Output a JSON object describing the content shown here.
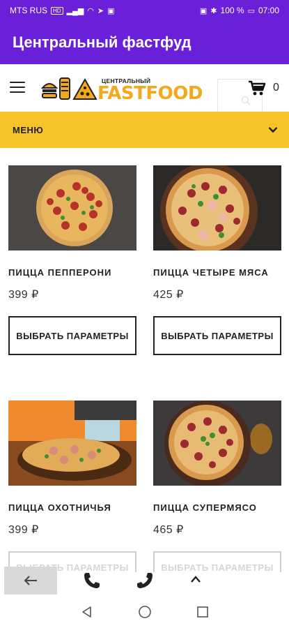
{
  "status_bar": {
    "carrier": "MTS RUS",
    "carrier_badge": "HD",
    "battery": "100 %",
    "time": "07:00"
  },
  "app_bar": {
    "title": "Центральный фастфуд"
  },
  "header": {
    "logo_small": "ЦЕНТРАЛЬНЫЙ",
    "logo_big": "FASTFOOD",
    "cart_count": "0"
  },
  "menu": {
    "label": "МЕНЮ"
  },
  "products": [
    {
      "name": "ПИЦЦА ПЕППЕРОНИ",
      "price": "399 ₽",
      "button": "ВЫБРАТЬ ПАРАМЕТРЫ"
    },
    {
      "name": "ПИЦЦА ЧЕТЫРЕ МЯСА",
      "price": "425 ₽",
      "button": "ВЫБРАТЬ ПАРАМЕТРЫ"
    },
    {
      "name": "ПИЦЦА ОХОТНИЧЬЯ",
      "price": "399 ₽",
      "button": "ВЫБРАТЬ ПАРАМЕТРЫ"
    },
    {
      "name": "ПИЦЦА СУПЕРМЯСО",
      "price": "465 ₽",
      "button": "ВЫБРАТЬ ПАРАМЕТРЫ"
    }
  ],
  "colors": {
    "app_bar": "#6a1fd9",
    "menu_bar": "#f6c32b",
    "logo_text": "#f2a91d"
  },
  "icons": [
    "hamburger-icon",
    "search-icon",
    "cart-icon",
    "chevron-down-icon",
    "back-arrow-icon",
    "phone-icon",
    "up-arrow-icon",
    "nav-back-icon",
    "nav-home-icon",
    "nav-recents-icon"
  ]
}
